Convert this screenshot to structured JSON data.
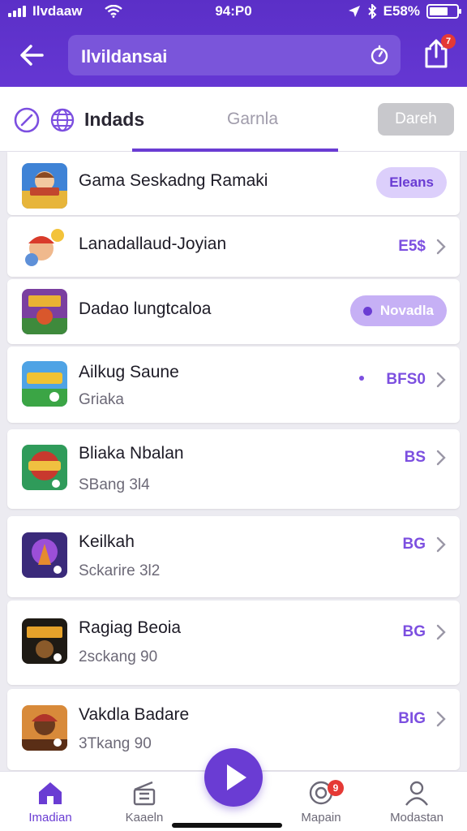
{
  "status_bar": {
    "carrier": "Ilvdaaw",
    "time": "94:P0",
    "battery": "E58%"
  },
  "header": {
    "search_value": "Ilvildansai"
  },
  "tabs": {
    "title": "Indads",
    "second": "Garnla",
    "button": "Dareh"
  },
  "badges": {
    "share": "7",
    "mapain": "9"
  },
  "items": [
    {
      "title": "Gama Seskadng Ramaki",
      "subtitle": "",
      "action": "Eleans",
      "action_type": "pill"
    },
    {
      "title": "Lanadallaud-Joyian",
      "subtitle": "",
      "action": "E5$",
      "action_type": "price"
    },
    {
      "title": "Dadao lungtcaloa",
      "subtitle": "",
      "action": "Novadla",
      "action_type": "pill-dark"
    },
    {
      "title": "Ailkug Saune",
      "subtitle": "Griaka",
      "action": "BFS0",
      "action_type": "price"
    },
    {
      "title": "Bliaka Nbalan",
      "subtitle": "SBang 3l4",
      "action": "BS",
      "action_type": "price"
    },
    {
      "title": "Keilkah",
      "subtitle": "Sckarire 3l2",
      "action": "BG",
      "action_type": "price"
    },
    {
      "title": "Ragiag Beoia",
      "subtitle": "2sckang 90",
      "action": "BG",
      "action_type": "price"
    },
    {
      "title": "Vakdla Badare",
      "subtitle": "3Tkang 90",
      "action": "BIG",
      "action_type": "price"
    }
  ],
  "bottom_nav": [
    {
      "label": "Imadian",
      "icon": "home-icon",
      "active": true
    },
    {
      "label": "Kaaeln",
      "icon": "clapperboard-icon",
      "active": false
    },
    {
      "label": "Mapain",
      "icon": "target-icon",
      "active": false
    },
    {
      "label": "Modastan",
      "icon": "profile-icon",
      "active": false
    }
  ],
  "colors": {
    "accent": "#6A3CD3",
    "header": "#5B2FC7",
    "price": "#7C4FE0",
    "badge": "#E53935"
  }
}
